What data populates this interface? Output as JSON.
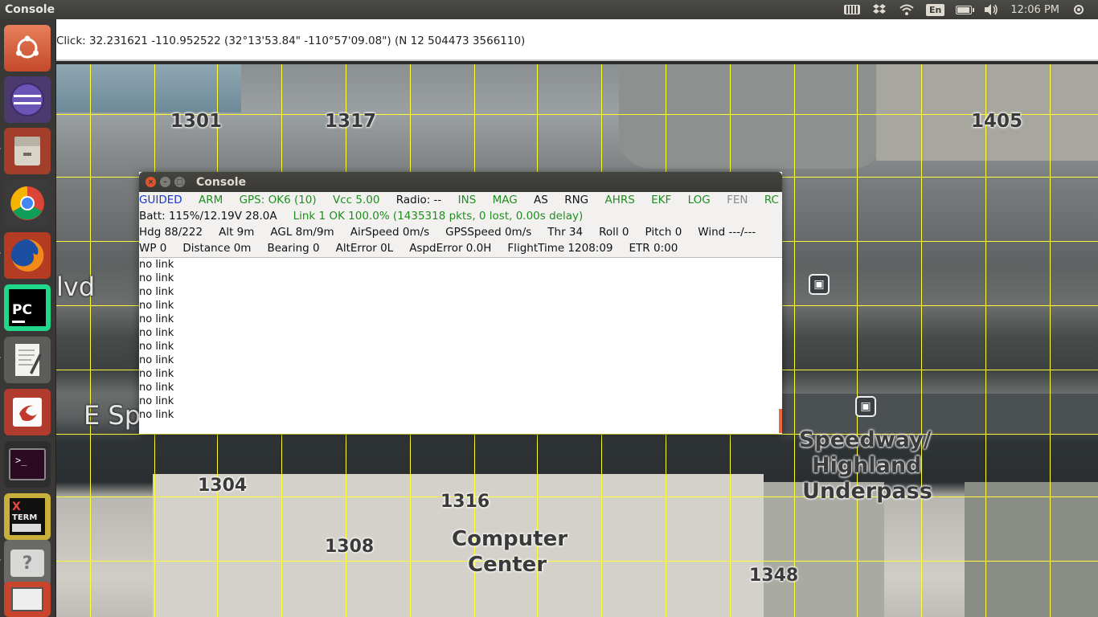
{
  "top_panel": {
    "title": "Console",
    "lang": "En",
    "time": "12:06 PM",
    "icons": [
      "keyboard-icon",
      "dropbox-icon",
      "wifi-icon",
      "language-icon",
      "battery-icon",
      "volume-icon"
    ]
  },
  "launcher": {
    "items": [
      "ubuntu-dash",
      "eclipse",
      "files",
      "chrome",
      "firefox",
      "pycharm",
      "text-editor",
      "evince",
      "terminal",
      "xterm",
      "unknown-app",
      "mavproxy-map"
    ]
  },
  "click_bar": {
    "text": "Click: 32.231621 -110.952522 (32°13'53.84\" -110°57'09.08\") (N 12 504473 3566110)"
  },
  "map": {
    "labels": {
      "l1301": "1301",
      "l1317": "1317",
      "l1405": "1405",
      "lvd": "lvd",
      "esp": "E Sp",
      "speedway": "Speedway/",
      "highland": "Highland",
      "underpass": "Underpass",
      "l1304": "1304",
      "l1316": "1316",
      "l1308": "1308",
      "computer": "Computer",
      "center": "Center",
      "l1348": "1348"
    }
  },
  "console": {
    "title": "Console",
    "row1": {
      "mode": "GUIDED",
      "arm": "ARM",
      "gps": "GPS: OK6 (10)",
      "vcc": "Vcc 5.00",
      "radio": "Radio: --",
      "ins": "INS",
      "mag": "MAG",
      "as": "AS",
      "rng": "RNG",
      "ahrs": "AHRS",
      "ekf": "EKF",
      "log": "LOG",
      "fen": "FEN",
      "rc": "RC"
    },
    "row2": {
      "batt": "Batt: 115%/12.19V 28.0A",
      "link": "Link 1 OK 100.0% (1435318 pkts, 0 lost, 0.00s delay)"
    },
    "row3": {
      "hdg": "Hdg 88/222",
      "alt": "Alt 9m",
      "agl": "AGL 8m/9m",
      "airspeed": "AirSpeed 0m/s",
      "gpsspeed": "GPSSpeed 0m/s",
      "thr": "Thr 34",
      "roll": "Roll 0",
      "pitch": "Pitch 0",
      "wind": "Wind ---/---"
    },
    "row4": {
      "wp": "WP 0",
      "distance": "Distance 0m",
      "bearing": "Bearing 0",
      "alterror": "AltError 0L",
      "aspderror": "AspdError 0.0H",
      "flighttime": "FlightTime 1208:09",
      "etr": "ETR 0:00"
    },
    "log": [
      "no link",
      "no link",
      "no link",
      "no link",
      "no link",
      "no link",
      "no link",
      "no link",
      "no link",
      "no link",
      "no link",
      "no link"
    ]
  }
}
